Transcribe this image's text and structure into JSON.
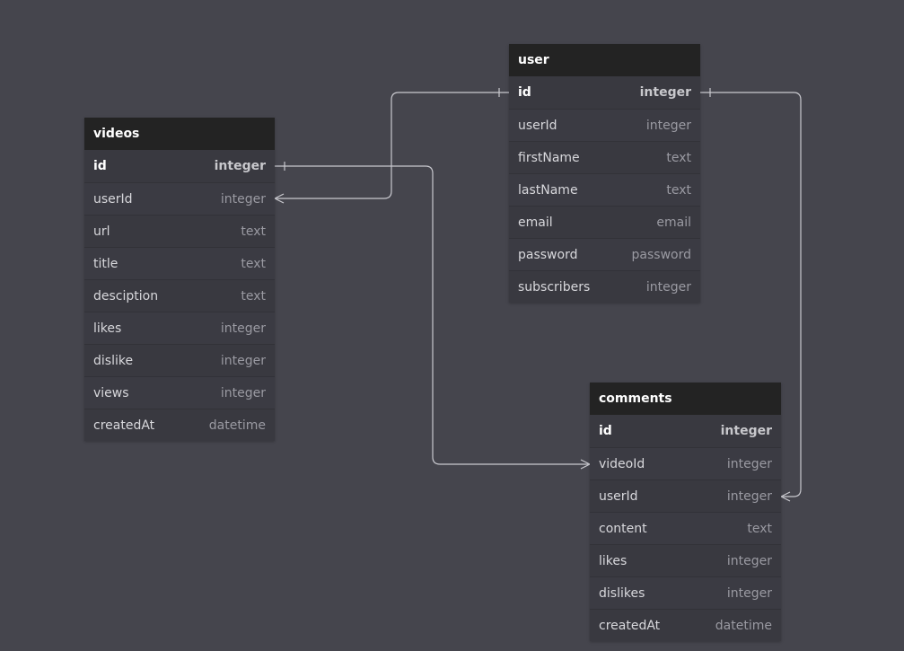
{
  "tables": {
    "videos": {
      "name": "videos",
      "fields": [
        {
          "name": "id",
          "type": "integer"
        },
        {
          "name": "userId",
          "type": "integer"
        },
        {
          "name": "url",
          "type": "text"
        },
        {
          "name": "title",
          "type": "text"
        },
        {
          "name": "desciption",
          "type": "text"
        },
        {
          "name": "likes",
          "type": "integer"
        },
        {
          "name": "dislike",
          "type": "integer"
        },
        {
          "name": "views",
          "type": "integer"
        },
        {
          "name": "createdAt",
          "type": "datetime"
        }
      ]
    },
    "user": {
      "name": "user",
      "fields": [
        {
          "name": "id",
          "type": "integer"
        },
        {
          "name": "userId",
          "type": "integer"
        },
        {
          "name": "firstName",
          "type": "text"
        },
        {
          "name": "lastName",
          "type": "text"
        },
        {
          "name": "email",
          "type": "email"
        },
        {
          "name": "password",
          "type": "password"
        },
        {
          "name": "subscribers",
          "type": "integer"
        }
      ]
    },
    "comments": {
      "name": "comments",
      "fields": [
        {
          "name": "id",
          "type": "integer"
        },
        {
          "name": "videoId",
          "type": "integer"
        },
        {
          "name": "userId",
          "type": "integer"
        },
        {
          "name": "content",
          "type": "text"
        },
        {
          "name": "likes",
          "type": "integer"
        },
        {
          "name": "dislikes",
          "type": "integer"
        },
        {
          "name": "createdAt",
          "type": "datetime"
        }
      ]
    }
  },
  "relations": [
    {
      "from": "videos.userId",
      "to": "user.id",
      "cardinality": "many-to-one"
    },
    {
      "from": "comments.videoId",
      "to": "videos.id",
      "cardinality": "many-to-one"
    },
    {
      "from": "comments.userId",
      "to": "user.id",
      "cardinality": "many-to-one"
    }
  ],
  "colors": {
    "background": "#45454d",
    "header": "#232323",
    "connector": "#c9c9cf"
  }
}
